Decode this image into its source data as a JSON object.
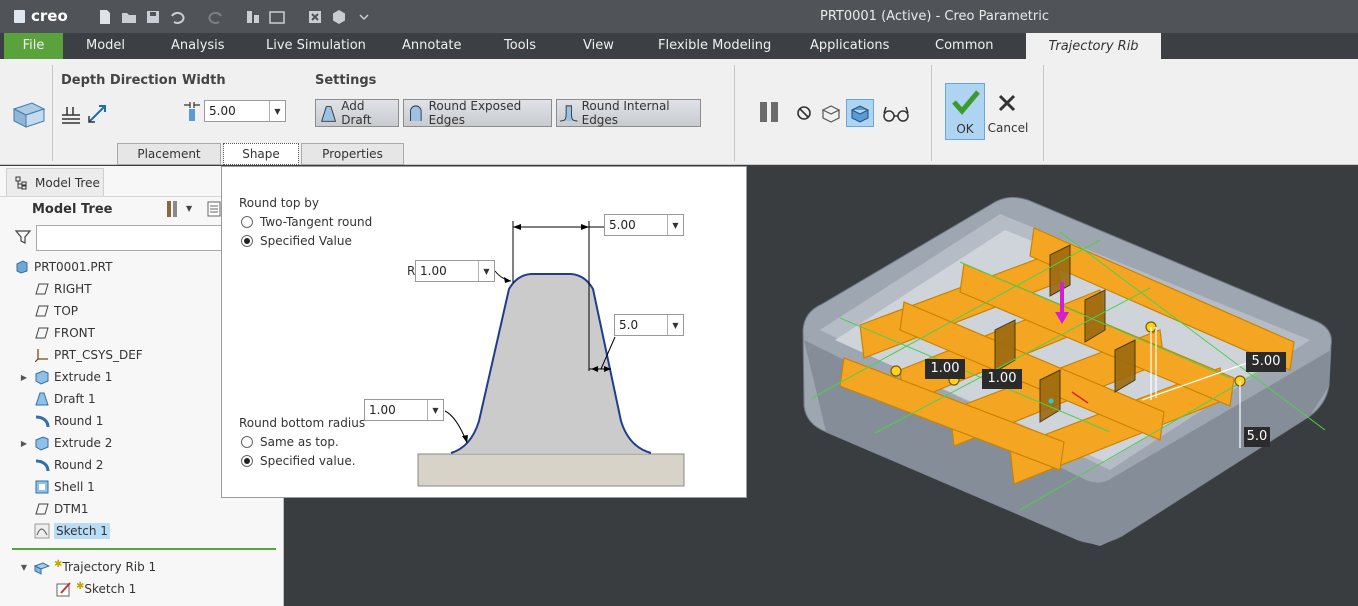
{
  "app": {
    "logo": "creo",
    "window_title": "PRT0001 (Active) - Creo Parametric"
  },
  "menu": {
    "file": "File",
    "items": [
      "Model",
      "Analysis",
      "Live Simulation",
      "Annotate",
      "Tools",
      "View",
      "Flexible Modeling",
      "Applications",
      "Common"
    ],
    "active_tab": "Trajectory Rib"
  },
  "ribbon": {
    "depth_direction": "Depth Direction",
    "width_label": "Width",
    "width_value": "5.00",
    "settings_label": "Settings",
    "add_draft": "Add Draft",
    "round_exposed": "Round Exposed Edges",
    "round_internal": "Round Internal Edges",
    "ok": "OK",
    "cancel": "Cancel",
    "subtabs": [
      "Placement",
      "Shape",
      "Properties"
    ]
  },
  "tree": {
    "tab_label": "Model Tree",
    "header": "Model Tree",
    "items": [
      {
        "label": "PRT0001.PRT",
        "icon": "part-icon"
      },
      {
        "label": "RIGHT",
        "icon": "datum-plane-icon"
      },
      {
        "label": "TOP",
        "icon": "datum-plane-icon"
      },
      {
        "label": "FRONT",
        "icon": "datum-plane-icon"
      },
      {
        "label": "PRT_CSYS_DEF",
        "icon": "csys-icon"
      },
      {
        "label": "Extrude 1",
        "icon": "extrude-icon"
      },
      {
        "label": "Draft 1",
        "icon": "draft-icon"
      },
      {
        "label": "Round 1",
        "icon": "round-icon"
      },
      {
        "label": "Extrude 2",
        "icon": "extrude-icon"
      },
      {
        "label": "Round 2",
        "icon": "round-icon"
      },
      {
        "label": "Shell 1",
        "icon": "shell-icon"
      },
      {
        "label": "DTM1",
        "icon": "datum-plane-icon"
      },
      {
        "label": "Sketch 1",
        "icon": "sketch-icon"
      },
      {
        "label": "Trajectory Rib 1",
        "icon": "rib-icon"
      },
      {
        "label": "Sketch 1",
        "icon": "sketch-icon"
      }
    ]
  },
  "shape": {
    "round_top_by": "Round top by",
    "two_tangent": "Two-Tangent round",
    "specified_value": "Specified Value",
    "r_label": "R",
    "top_radius": "1.00",
    "width_value": "5.00",
    "draft_value": "5.0",
    "round_bottom_label": "Round bottom radius",
    "bottom_radius": "1.00",
    "same_as_top": "Same as top.",
    "specified_value_2": "Specified value."
  },
  "viewport": {
    "dim_1": "1.00",
    "dim_2": "1.00",
    "dim_3": "5.00",
    "dim_4": "5.0"
  }
}
